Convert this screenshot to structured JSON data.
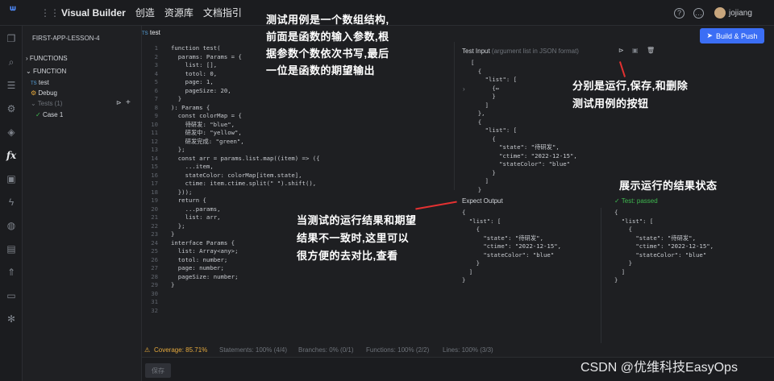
{
  "topbar": {
    "app_name": "Visual Builder",
    "nav": [
      "创造",
      "资源库",
      "文档指引"
    ],
    "help_icon": "?",
    "chat_icon": "…",
    "username": "jojiang"
  },
  "build_button": {
    "label": "Build & Push",
    "icon": "send-icon"
  },
  "explorer": {
    "project": "FIRST-APP-LESSON-4",
    "sections": [
      "FUNCTIONS",
      "FUNCTION"
    ],
    "files": [
      {
        "badge": "TS",
        "name": "test"
      },
      {
        "badge": "",
        "name": "Debug"
      }
    ],
    "tests_label": "Tests (1)",
    "case_label": "Case 1"
  },
  "editor": {
    "tab_badge": "TS",
    "tab_name": "test",
    "line_numbers": [
      "1",
      "2",
      "3",
      "4",
      "5",
      "6",
      "7",
      "8",
      "9",
      "10",
      "11",
      "12",
      "13",
      "14",
      "15",
      "16",
      "17",
      "18",
      "19",
      "20",
      "21",
      "22",
      "23",
      "24",
      "25",
      "26",
      "27",
      "28",
      "29",
      "30",
      "31",
      "32"
    ],
    "lines": [
      "function test(",
      "  params: Params = {",
      "    list: [],",
      "    totol: 0,",
      "    page: 1,",
      "    pageSize: 20,",
      "  }",
      "): Params {",
      "  const colorMap = {",
      "    待研发: \"blue\",",
      "    研发中: \"yellow\",",
      "    研发完成: \"green\",",
      "  };",
      "  const arr = params.list.map((item) => ({",
      "    ...item,",
      "    stateColor: colorMap[item.state],",
      "    ctime: item.ctime.split(\" \").shift(),",
      "  }));",
      "",
      "  return {",
      "    ...params,",
      "    list: arr,",
      "  };",
      "}",
      "",
      "interface Params {",
      "  list: Array<any>;",
      "  totol: number;",
      "  page: number;",
      "  pageSize: number;",
      "}",
      ""
    ]
  },
  "test_input": {
    "title": "Test Input",
    "hint": "(argument list in JSON format)",
    "lines": [
      "[",
      "  {",
      "    \"list\": [",
      "      {↔",
      "      }",
      "    ]",
      "  },",
      "  {",
      "    \"list\": [",
      "      {",
      "        \"state\": \"待研发\",",
      "        \"ctime\": \"2022-12-15\",",
      "        \"stateColor\": \"blue\"",
      "      }",
      "    ]",
      "  }"
    ]
  },
  "expect_output": {
    "title": "Expect Output",
    "lines": [
      "{",
      "  \"list\": [",
      "    {",
      "      \"state\": \"待研发\",",
      "      \"ctime\": \"2022-12-15\",",
      "      \"stateColor\": \"blue\"",
      "    }",
      "  ]",
      "}"
    ]
  },
  "test_result": {
    "title": "Test: passed",
    "lines": [
      "{",
      "  \"list\": [",
      "    {",
      "      \"state\": \"待研发\",",
      "      \"ctime\": \"2022-12-15\",",
      "      \"stateColor\": \"blue\"",
      "    }",
      "  ]",
      "}"
    ]
  },
  "status": {
    "coverage": "Coverage: 85.71%",
    "statements": "Statements: 100% (4/4)",
    "branches": "Branches: 0% (0/1)",
    "functions": "Functions: 100% (2/2)",
    "lines": "Lines: 100% (3/3)"
  },
  "save_button": "保存",
  "annotations": {
    "a1": [
      "测试用例是一个数组结构,",
      "前面是函数的输入参数,根",
      "据参数个数依次书写,最后",
      "一位是函数的期望输出"
    ],
    "a2": [
      "分别是运行,保存,和删除",
      "测试用例的按钮"
    ],
    "a3": "展示运行的结果状态",
    "a4": [
      "当测试的运行结果和期望",
      "结果不一致时,这里可以",
      "很方便的去对比,查看"
    ]
  },
  "watermark": "CSDN @优维科技EasyOps",
  "colors": {
    "accent": "#3b6ef5",
    "pass": "#3fb950",
    "annotation_arrow": "#e43131"
  }
}
